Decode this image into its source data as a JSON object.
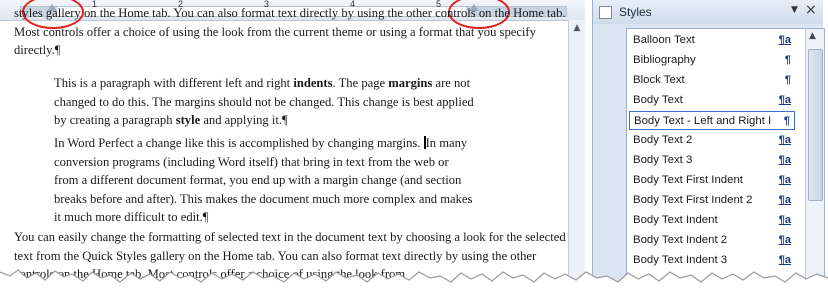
{
  "ruler": {
    "numbers": [
      "1",
      "2",
      "3",
      "4",
      "5"
    ]
  },
  "document": {
    "p_top": "styles gallery on the Home tab. You can also format text directly by using the other controls on the Home tab. Most controls offer a choice of using the look from the current theme or using a format that you specify directly.¶",
    "p_ind1_a": "This is a paragraph with different left and right ",
    "p_ind1_b": "indents",
    "p_ind1_c": ". The page ",
    "p_ind1_d": "margins",
    "p_ind1_e": " are not changed to do this. The margins should not be changed. This change is best applied by creating a paragraph ",
    "p_ind1_f": "style",
    "p_ind1_g": " and applying it.¶",
    "p_ind2_a": "In Word Perfect a change like this is accomplished by changing margins. ",
    "p_ind2_b": "In many conversion programs (including Word itself) that bring in text from the web or from a different document format, you end up with a margin change (and section breaks before and after). This makes the document much more complex and makes it much more difficult to edit.¶",
    "p_bot": "You can easily change the formatting of selected text in the document text by choosing a look for the selected text from the Quick Styles gallery on the Home tab. You can also format text directly by using the other controls on the Home tab. Most controls offer a choice of using the look from"
  },
  "styles_pane": {
    "title": "Styles",
    "dropdown_glyph": "▼",
    "close_glyph": "×",
    "items": [
      {
        "name": "Balloon Text",
        "mark": "¶a",
        "linked": true
      },
      {
        "name": "Bibliography",
        "mark": "¶",
        "linked": false
      },
      {
        "name": "Block Text",
        "mark": "¶",
        "linked": false
      },
      {
        "name": "Body Text",
        "mark": "¶a",
        "linked": true
      },
      {
        "name": "Body Text - Left and Right Indent",
        "mark": "¶",
        "linked": false,
        "selected": true
      },
      {
        "name": "Body Text 2",
        "mark": "¶a",
        "linked": true
      },
      {
        "name": "Body Text 3",
        "mark": "¶a",
        "linked": true
      },
      {
        "name": "Body Text First Indent",
        "mark": "¶a",
        "linked": true
      },
      {
        "name": "Body Text First Indent 2",
        "mark": "¶a",
        "linked": true
      },
      {
        "name": "Body Text Indent",
        "mark": "¶a",
        "linked": true
      },
      {
        "name": "Body Text Indent 2",
        "mark": "¶a",
        "linked": true
      },
      {
        "name": "Body Text Indent 3",
        "mark": "¶a",
        "linked": true
      }
    ]
  },
  "colors": {
    "highlight_ellipse": "#e02020",
    "link_mark": "#1a3a88",
    "selected_border": "#3d6fc9",
    "pane_background": "#dbe5f2"
  }
}
